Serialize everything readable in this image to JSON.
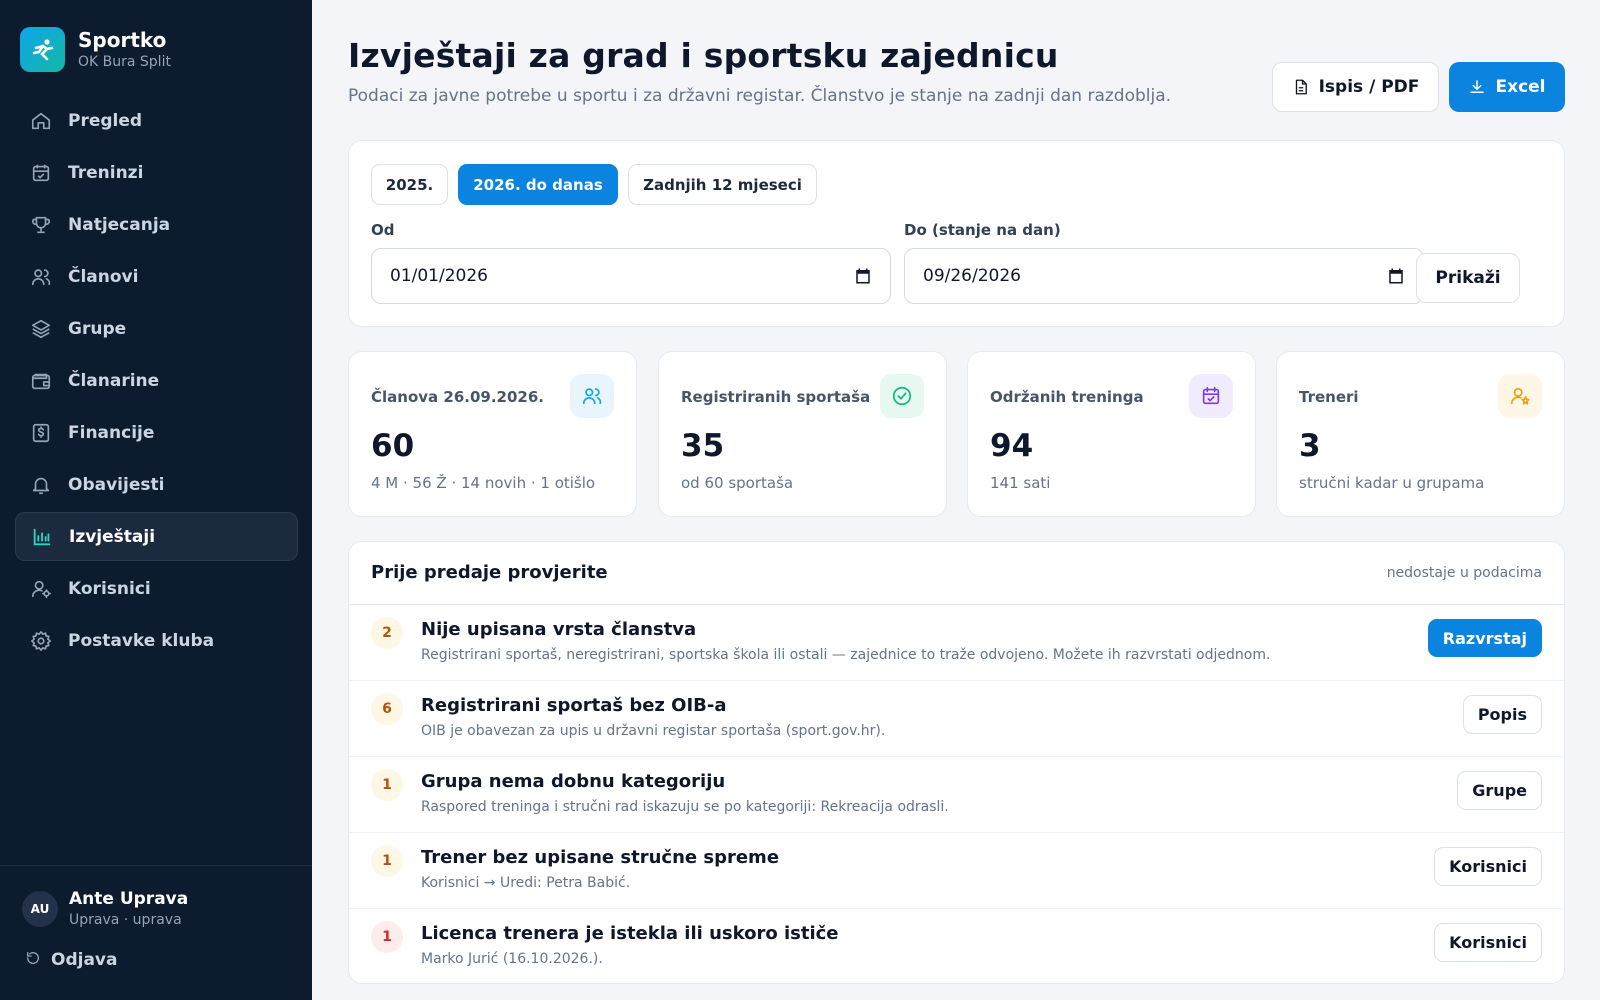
{
  "brand": {
    "name": "Sportko",
    "club": "OK Bura Split"
  },
  "sidebar": {
    "items": [
      {
        "label": "Pregled",
        "icon": "home-icon"
      },
      {
        "label": "Treninzi",
        "icon": "calendar-icon"
      },
      {
        "label": "Natjecanja",
        "icon": "trophy-icon"
      },
      {
        "label": "Članovi",
        "icon": "users-icon"
      },
      {
        "label": "Grupe",
        "icon": "layers-icon"
      },
      {
        "label": "Članarine",
        "icon": "wallet-icon"
      },
      {
        "label": "Financije",
        "icon": "dollar-receipt-icon"
      },
      {
        "label": "Obavijesti",
        "icon": "bell-icon"
      },
      {
        "label": "Izvještaji",
        "icon": "bar-chart-icon",
        "active": true
      },
      {
        "label": "Korisnici",
        "icon": "user-cog-icon"
      },
      {
        "label": "Postavke kluba",
        "icon": "gear-icon"
      }
    ]
  },
  "user": {
    "initials": "AU",
    "name": "Ante Uprava",
    "role": "Uprava · uprava"
  },
  "logout": {
    "label": "Odjava"
  },
  "header": {
    "title": "Izvještaji za grad i sportsku zajednicu",
    "subtitle": "Podaci za javne potrebe u sportu i za državni registar. Članstvo je stanje na zadnji dan razdoblja.",
    "pdf_label": "Ispis / PDF",
    "excel_label": "Excel"
  },
  "filters": {
    "chips": [
      {
        "label": "2025.",
        "active": false
      },
      {
        "label": "2026. do danas",
        "active": true
      },
      {
        "label": "Zadnjih 12 mjeseci",
        "active": false
      }
    ],
    "from_label": "Od",
    "from_value": "01/01/2026",
    "to_label": "Do (stanje na dan)",
    "to_value": "09/26/2026",
    "show_label": "Prikaži"
  },
  "stats": [
    {
      "label": "Članova 26.09.2026.",
      "value": "60",
      "note": "4 M · 56 Ž · 14 novih · 1 otišlo",
      "icon": "users-icon",
      "color": "#0ea5e9",
      "bg": "#e8f5fd"
    },
    {
      "label": "Registriranih sportaša",
      "value": "35",
      "note": "od 60 sportaša",
      "icon": "check-circle-icon",
      "color": "#10b981",
      "bg": "#e7f8f1"
    },
    {
      "label": "Održanih treninga",
      "value": "94",
      "note": "141 sati",
      "icon": "calendar-check-icon",
      "color": "#7c3aed",
      "bg": "#f1ecfd"
    },
    {
      "label": "Treneri",
      "value": "3",
      "note": "stručni kadar u grupama",
      "icon": "user-star-icon",
      "color": "#f59e0b",
      "bg": "#fef6e6"
    }
  ],
  "checks": {
    "title": "Prije predaje provjerite",
    "hint": "nedostaje u podacima",
    "rows": [
      {
        "count": "2",
        "title": "Nije upisana vrsta članstva",
        "desc": "Registrirani sportaš, neregistrirani, sportska škola ili ostali — zajednice to traže odvojeno. Možete ih razvrstati odjednom.",
        "action": "Razvrstaj",
        "primary": true,
        "severity": "warn"
      },
      {
        "count": "6",
        "title": "Registrirani sportaš bez OIB-a",
        "desc": "OIB je obavezan za upis u državni registar sportaša (sport.gov.hr).",
        "action": "Popis",
        "primary": false,
        "severity": "warn"
      },
      {
        "count": "1",
        "title": "Grupa nema dobnu kategoriju",
        "desc": "Raspored treninga i stručni rad iskazuju se po kategoriji: Rekreacija odrasli.",
        "action": "Grupe",
        "primary": false,
        "severity": "warn"
      },
      {
        "count": "1",
        "title": "Trener bez upisane stručne spreme",
        "desc": "Korisnici → Uredi: Petra Babić.",
        "action": "Korisnici",
        "primary": false,
        "severity": "warn"
      },
      {
        "count": "1",
        "title": "Licenca trenera je istekla ili uskoro ističe",
        "desc": "Marko Jurić (16.10.2026.).",
        "action": "Korisnici",
        "primary": false,
        "severity": "danger"
      }
    ]
  },
  "colors": {
    "accent": "#0b84e0",
    "sidebar_bg": "#0d1b2e",
    "page_bg": "#f3f5f8"
  }
}
